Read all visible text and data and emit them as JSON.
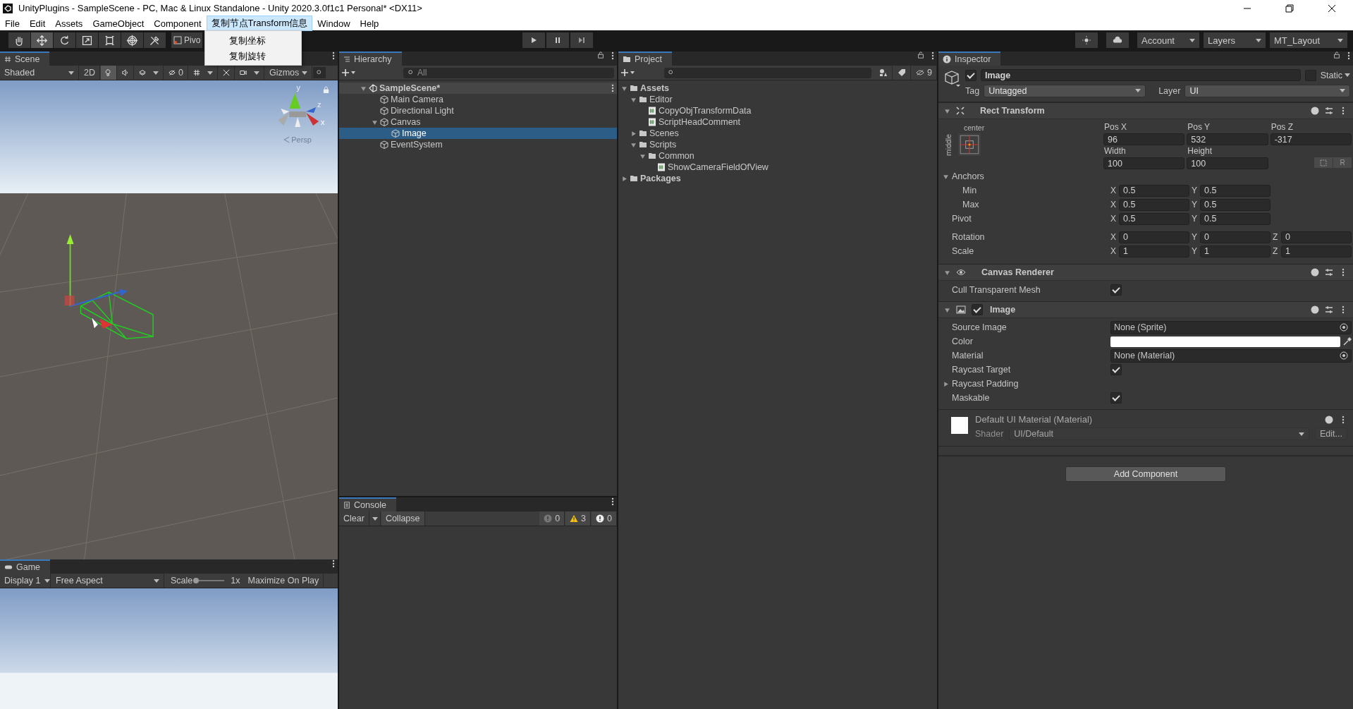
{
  "window": {
    "title": "UnityPlugins - SampleScene - PC, Mac & Linux Standalone - Unity 2020.3.0f1c1 Personal* <DX11>"
  },
  "menu_bar": [
    {
      "label": "File",
      "selected": false
    },
    {
      "label": "Edit",
      "selected": false
    },
    {
      "label": "Assets",
      "selected": false
    },
    {
      "label": "GameObject",
      "selected": false
    },
    {
      "label": "Component",
      "selected": false
    },
    {
      "label": "复制节点Transform信息",
      "selected": true
    },
    {
      "label": "Window",
      "selected": false
    },
    {
      "label": "Help",
      "selected": false
    }
  ],
  "open_menu": {
    "items": [
      "复制坐标",
      "复制旋转"
    ]
  },
  "toolbar": {
    "tools": [
      {
        "kind": "hand",
        "selected": false
      },
      {
        "kind": "move",
        "selected": true
      },
      {
        "kind": "rotate",
        "selected": false
      },
      {
        "kind": "scale",
        "selected": false
      },
      {
        "kind": "rect",
        "selected": false
      },
      {
        "kind": "transform",
        "selected": false
      },
      {
        "kind": "custom",
        "selected": false
      }
    ],
    "pivot": "Pivo",
    "account": "Account",
    "layers": "Layers",
    "layout": "MT_Layout"
  },
  "scene": {
    "tab": "Scene",
    "shading": "Shaded",
    "mode_2d": "2D",
    "mode_2d_on": false,
    "toggles": [
      {
        "kind": "lighting",
        "on": true,
        "menu": false
      },
      {
        "kind": "audio",
        "on": false,
        "menu": false
      },
      {
        "kind": "effects",
        "on": false,
        "menu": true
      },
      {
        "kind": "visibility",
        "on": false,
        "menu": false,
        "count": "0"
      },
      {
        "kind": "grid",
        "on": false,
        "menu": true
      },
      {
        "kind": "tools",
        "on": false,
        "menu": false
      },
      {
        "kind": "camera",
        "on": false,
        "menu": true
      }
    ],
    "gizmos": "Gizmos",
    "axes": [
      "y",
      "z",
      "x"
    ],
    "projection": "Persp"
  },
  "hierarchy": {
    "tab": "Hierarchy",
    "search_placeholder": "All",
    "items": [
      {
        "label": "SampleScene*",
        "kind": "scene",
        "expanded": true,
        "selected": false,
        "children": [
          {
            "label": "Main Camera",
            "kind": "object",
            "selected": false
          },
          {
            "label": "Directional Light",
            "kind": "object",
            "selected": false
          },
          {
            "label": "Canvas",
            "kind": "object",
            "expanded": true,
            "selected": false,
            "children": [
              {
                "label": "Image",
                "kind": "object",
                "selected": true
              }
            ]
          },
          {
            "label": "EventSystem",
            "kind": "object",
            "selected": false
          }
        ]
      }
    ]
  },
  "project": {
    "tab": "Project",
    "hidden_count": "9",
    "tree": [
      {
        "label": "Assets",
        "kind": "folder",
        "expanded": true,
        "children": [
          {
            "label": "Editor",
            "kind": "folder",
            "expanded": true,
            "children": [
              {
                "label": "CopyObjTransformData",
                "kind": "script"
              },
              {
                "label": "ScriptHeadComment",
                "kind": "script"
              }
            ]
          },
          {
            "label": "Scenes",
            "kind": "folder",
            "expanded": false
          },
          {
            "label": "Scripts",
            "kind": "folder",
            "expanded": true,
            "children": [
              {
                "label": "Common",
                "kind": "folder",
                "expanded": true,
                "children": [
                  {
                    "label": "ShowCameraFieldOfView",
                    "kind": "script"
                  }
                ]
              }
            ]
          }
        ]
      },
      {
        "label": "Packages",
        "kind": "folder",
        "expanded": false
      }
    ]
  },
  "console": {
    "tab": "Console",
    "clear": "Clear",
    "collapse": "Collapse",
    "counts": [
      {
        "kind": "info",
        "count": "0"
      },
      {
        "kind": "warning",
        "count": "3"
      },
      {
        "kind": "error",
        "count": "0"
      }
    ]
  },
  "game": {
    "tab": "Game",
    "display": "Display 1",
    "aspect": "Free Aspect",
    "scale_label": "Scale",
    "level": 0,
    "scale_value": "1x",
    "maximize": "Maximize On Play"
  },
  "inspector": {
    "tab": "Inspector",
    "object": {
      "active": true,
      "name": "Image",
      "static": false,
      "static_label": "Static",
      "tag_label": "Tag",
      "tag": "Untagged",
      "layer_label": "Layer",
      "layer": "UI"
    },
    "rect_transform": {
      "title": "Rect Transform",
      "expanded": true,
      "anchor_h": "center",
      "anchor_v": "middle",
      "position": [
        {
          "label": "Pos X",
          "value": "96"
        },
        {
          "label": "Pos Y",
          "value": "532"
        },
        {
          "label": "Pos Z",
          "value": "-317"
        }
      ],
      "size": [
        {
          "label": "Width",
          "value": "100"
        },
        {
          "label": "Height",
          "value": "100"
        }
      ],
      "raw_button": "R",
      "anchors": {
        "label": "Anchors",
        "expanded": true,
        "children": [
          {
            "label": "Min",
            "axes": [
              {
                "axis": "X",
                "value": "0.5"
              },
              {
                "axis": "Y",
                "value": "0.5"
              }
            ]
          },
          {
            "label": "Max",
            "axes": [
              {
                "axis": "X",
                "value": "0.5"
              },
              {
                "axis": "Y",
                "value": "0.5"
              }
            ]
          }
        ]
      },
      "rows": [
        {
          "label": "Pivot",
          "axes": [
            {
              "axis": "X",
              "value": "0.5"
            },
            {
              "axis": "Y",
              "value": "0.5"
            }
          ]
        },
        {
          "label": "Rotation",
          "axes": [
            {
              "axis": "X",
              "value": "0"
            },
            {
              "axis": "Y",
              "value": "0"
            },
            {
              "axis": "Z",
              "value": "0"
            }
          ]
        },
        {
          "label": "Scale",
          "axes": [
            {
              "axis": "X",
              "value": "1"
            },
            {
              "axis": "Y",
              "value": "1"
            },
            {
              "axis": "Z",
              "value": "1"
            }
          ]
        }
      ]
    },
    "canvas_renderer": {
      "title": "Canvas Renderer",
      "expanded": true,
      "props": [
        {
          "label": "Cull Transparent Mesh",
          "kind": "toggle",
          "checked": true
        }
      ]
    },
    "image": {
      "title": "Image",
      "expanded": true,
      "enabled": true,
      "props": [
        {
          "label": "Source Image",
          "kind": "object",
          "value": "None (Sprite)"
        },
        {
          "label": "Color",
          "kind": "color",
          "color": "#ffffff"
        },
        {
          "label": "Material",
          "kind": "object",
          "value": "None (Material)"
        },
        {
          "label": "Raycast Target",
          "kind": "toggle",
          "checked": true
        },
        {
          "label": "Raycast Padding",
          "kind": "foldout",
          "expanded": false
        },
        {
          "label": "Maskable",
          "kind": "toggle",
          "checked": true
        }
      ]
    },
    "material": {
      "title": "Default UI Material (Material)",
      "shader_label": "Shader",
      "shader": "UI/Default",
      "edit": "Edit..."
    },
    "add_component": "Add Component"
  }
}
